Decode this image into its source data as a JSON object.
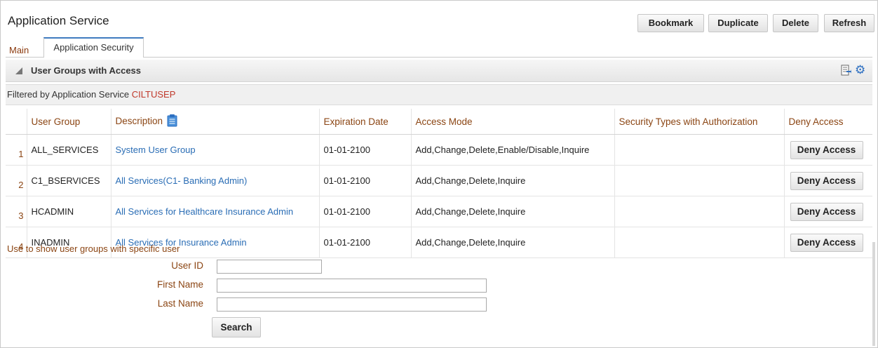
{
  "page": {
    "title": "Application Service",
    "actions": [
      "Bookmark",
      "Duplicate",
      "Delete",
      "Refresh"
    ]
  },
  "tabs": {
    "main": "Main",
    "security": "Application Security"
  },
  "section": {
    "title": "User Groups with Access",
    "icons": [
      "export-icon",
      "gear-icon"
    ]
  },
  "filter": {
    "label": "Filtered by Application Service",
    "value": "CILTUSEP"
  },
  "table": {
    "columns": [
      "User Group",
      "Description",
      "Expiration Date",
      "Access Mode",
      "Security Types with Authorization",
      "Deny Access"
    ],
    "rows": [
      {
        "num": "1",
        "group": "ALL_SERVICES",
        "description": "System User Group",
        "expiration": "01-01-2100",
        "mode": "Add,Change,Delete,Enable/Disable,Inquire",
        "security_types": "",
        "deny": "Deny Access"
      },
      {
        "num": "2",
        "group": "C1_BSERVICES",
        "description": "All Services(C1- Banking Admin)",
        "expiration": "01-01-2100",
        "mode": "Add,Change,Delete,Inquire",
        "security_types": "",
        "deny": "Deny Access"
      },
      {
        "num": "3",
        "group": "HCADMIN",
        "description": "All Services for Healthcare Insurance Admin",
        "expiration": "01-01-2100",
        "mode": "Add,Change,Delete,Inquire",
        "security_types": "",
        "deny": "Deny Access"
      },
      {
        "num": "4",
        "group": "INADMIN",
        "description": "All Services for Insurance Admin",
        "expiration": "01-01-2100",
        "mode": "Add,Change,Delete,Inquire",
        "security_types": "",
        "deny": "Deny Access"
      }
    ]
  },
  "user_filter": {
    "hint": "Use to show user groups with specific user",
    "user_id_label": "User ID",
    "user_id_value": "",
    "first_name_label": "First Name",
    "first_name_value": "",
    "last_name_label": "Last Name",
    "last_name_value": "",
    "search_label": "Search"
  },
  "colors": {
    "label_brown": "#8b4513",
    "link_blue": "#2a6db5",
    "filter_red": "#c0392b",
    "tab_accent": "#3f7bbf"
  }
}
